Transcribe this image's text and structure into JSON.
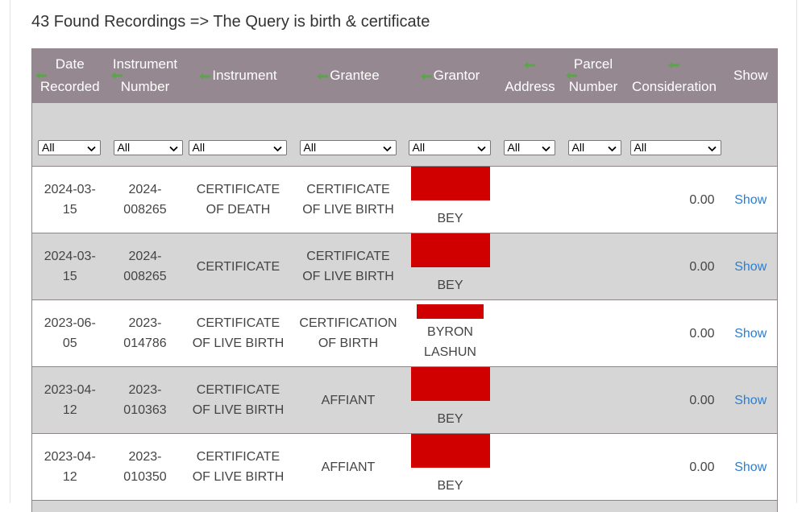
{
  "page": {
    "title": "43 Found Recordings => The Query is birth & certificate"
  },
  "table": {
    "columns": [
      {
        "line1": "Date",
        "line2": "Recorded",
        "sort_icon": "sort-arrow-icon"
      },
      {
        "line1": "Instrument",
        "line2": "Number",
        "sort_icon": "sort-arrow-icon"
      },
      {
        "line1": "Instrument",
        "line2": "",
        "sort_icon": "sort-arrow-icon"
      },
      {
        "line1": "Grantee",
        "line2": "",
        "sort_icon": "sort-arrow-icon"
      },
      {
        "line1": "Grantor",
        "line2": "",
        "sort_icon": "sort-arrow-icon"
      },
      {
        "line1": "Address",
        "line2": "",
        "sort_icon": "sort-arrow-icon"
      },
      {
        "line1": "Parcel",
        "line2": "Number",
        "sort_icon": "sort-arrow-icon"
      },
      {
        "line1": "Consideration",
        "line2": "",
        "sort_icon": "sort-arrow-icon"
      },
      {
        "line1": "Show",
        "line2": "",
        "sort_icon": ""
      }
    ],
    "filters": [
      "All",
      "All",
      "All",
      "All",
      "All",
      "All",
      "All",
      "All"
    ],
    "rows": [
      {
        "date_1": "2024-03-",
        "date_2": "15",
        "number_1": "2024-",
        "number_2": "008265",
        "instrument_1": "CERTIFICATE",
        "instrument_2": "OF DEATH",
        "grantee_1": "CERTIFICATE",
        "grantee_2": "OF LIVE BIRTH",
        "grantor_redacted": "large",
        "grantor_1": "BEY",
        "grantor_2": "",
        "address": "",
        "parcel": "",
        "consideration": "0.00",
        "show": "Show"
      },
      {
        "date_1": "2024-03-",
        "date_2": "15",
        "number_1": "2024-",
        "number_2": "008265",
        "instrument_1": "CERTIFICATE",
        "instrument_2": "",
        "grantee_1": "CERTIFICATE",
        "grantee_2": "OF LIVE BIRTH",
        "grantor_redacted": "large",
        "grantor_1": "BEY",
        "grantor_2": "",
        "address": "",
        "parcel": "",
        "consideration": "0.00",
        "show": "Show"
      },
      {
        "date_1": "2023-06-",
        "date_2": "05",
        "number_1": "2023-",
        "number_2": "014786",
        "instrument_1": "CERTIFICATE",
        "instrument_2": "OF LIVE BIRTH",
        "grantee_1": "CERTIFICATION",
        "grantee_2": "OF BIRTH",
        "grantor_redacted": "small",
        "grantor_1": "BYRON",
        "grantor_2": "LASHUN",
        "address": "",
        "parcel": "",
        "consideration": "0.00",
        "show": "Show"
      },
      {
        "date_1": "2023-04-",
        "date_2": "12",
        "number_1": "2023-",
        "number_2": "010363",
        "instrument_1": "CERTIFICATE",
        "instrument_2": "OF LIVE BIRTH",
        "grantee_1": "AFFIANT",
        "grantee_2": "",
        "grantor_redacted": "large",
        "grantor_1": "BEY",
        "grantor_2": "",
        "address": "",
        "parcel": "",
        "consideration": "0.00",
        "show": "Show"
      },
      {
        "date_1": "2023-04-",
        "date_2": "12",
        "number_1": "2023-",
        "number_2": "010350",
        "instrument_1": "CERTIFICATE",
        "instrument_2": "OF LIVE BIRTH",
        "grantee_1": "AFFIANT",
        "grantee_2": "",
        "grantor_redacted": "large",
        "grantor_1": "BEY",
        "grantor_2": "",
        "address": "",
        "parcel": "",
        "consideration": "0.00",
        "show": "Show"
      }
    ]
  },
  "colors": {
    "header_bg": "#968890",
    "filter_bg": "#d4d4d4",
    "even_row_bg": "#d6d6d6",
    "redaction": "#d10000",
    "link": "#2a7ed3",
    "sort_arrow": "#5aa54a"
  }
}
